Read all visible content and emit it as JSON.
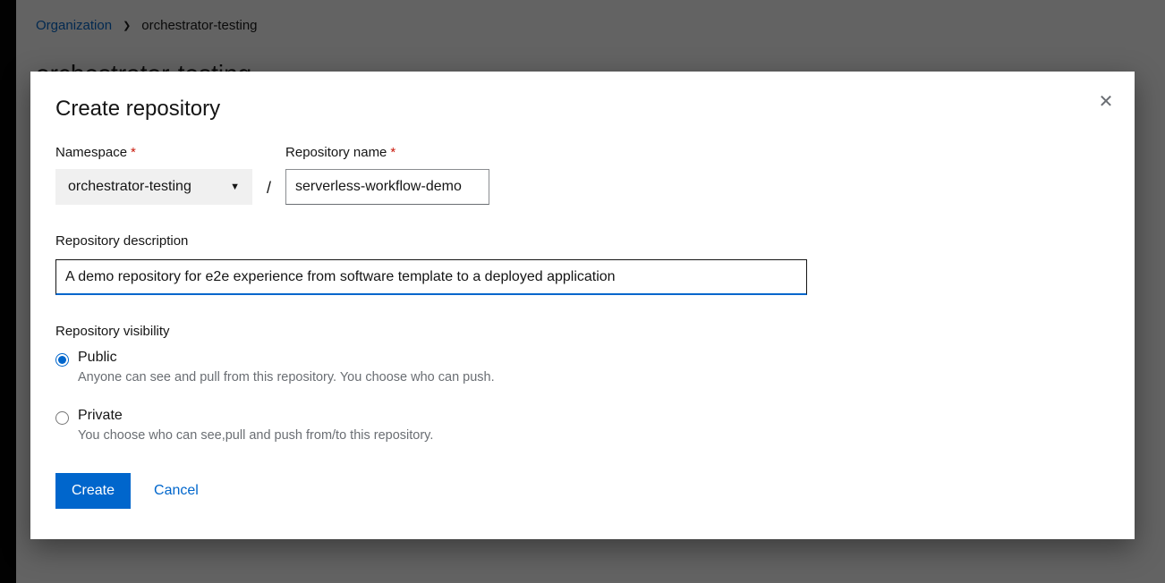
{
  "breadcrumbs": {
    "parent": "Organization",
    "current": "orchestrator-testing"
  },
  "page_title": "orchestrator-testing",
  "modal": {
    "title": "Create repository",
    "namespace_label": "Namespace",
    "namespace_value": "orchestrator-testing",
    "repo_name_label": "Repository name",
    "repo_name_value": "serverless-workflow-demo",
    "slash": "/",
    "desc_label": "Repository description",
    "desc_value": "A demo repository for e2e experience from software template to a deployed application",
    "visibility_label": "Repository visibility",
    "visibility": {
      "public": {
        "label": "Public",
        "help": "Anyone can see and pull from this repository. You choose who can push.",
        "checked": true
      },
      "private": {
        "label": "Private",
        "help": "You choose who can see,pull and push from/to this repository.",
        "checked": false
      }
    },
    "create_label": "Create",
    "cancel_label": "Cancel"
  }
}
